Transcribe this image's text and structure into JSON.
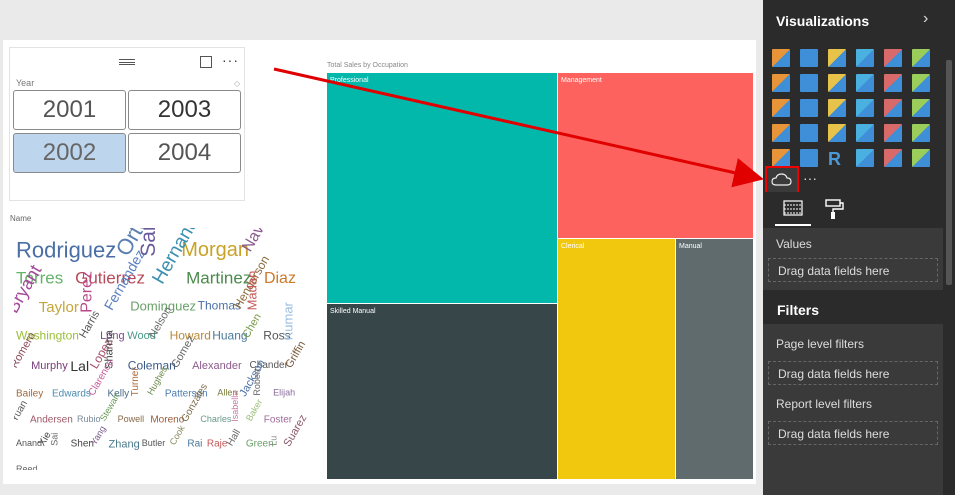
{
  "slicer": {
    "title": "Year",
    "years": [
      "2001",
      "2003",
      "2002",
      "2004"
    ],
    "selected": "2002",
    "more": "···"
  },
  "wordcloud": {
    "title": "Name",
    "words": [
      {
        "t": "Rodriguez",
        "c": "#4a6fa5"
      },
      {
        "t": "Ortega",
        "c": "#5b7fb0"
      },
      {
        "t": "Sanchez",
        "c": "#6a5a9c"
      },
      {
        "t": "Morgan",
        "c": "#c9a227"
      },
      {
        "t": "Navarro",
        "c": "#8b5a8c"
      },
      {
        "t": "Torres",
        "c": "#66b36a"
      },
      {
        "t": "Gutierrez",
        "c": "#b84a5a"
      },
      {
        "t": "Hernandez",
        "c": "#3b8fb0"
      },
      {
        "t": "Martinez",
        "c": "#4a8a4a"
      },
      {
        "t": "Diaz",
        "c": "#c97a2a"
      },
      {
        "t": "Bryant",
        "c": "#a34a9a"
      },
      {
        "t": "Taylor",
        "c": "#c4a63a"
      },
      {
        "t": "Perez",
        "c": "#b84a8a"
      },
      {
        "t": "Fernandez",
        "c": "#5a7fc0"
      },
      {
        "t": "Dominguez",
        "c": "#6aa06a"
      },
      {
        "t": "Thomas",
        "c": "#4a6fa5"
      },
      {
        "t": "Henderson",
        "c": "#8a6a3a"
      },
      {
        "t": "Madan",
        "c": "#c45a5a"
      },
      {
        "t": "Washington",
        "c": "#9abf3a"
      },
      {
        "t": "Harris",
        "c": "#555"
      },
      {
        "t": "Long",
        "c": "#7a4a8a"
      },
      {
        "t": "Wood",
        "c": "#4a9a8a"
      },
      {
        "t": "Nelson",
        "c": "#6a6a6a"
      },
      {
        "t": "Howard",
        "c": "#b8893a"
      },
      {
        "t": "Huang",
        "c": "#4a7a9a"
      },
      {
        "t": "Chen",
        "c": "#7a9a4a"
      },
      {
        "t": "Ross",
        "c": "#555"
      },
      {
        "t": "Kumar",
        "c": "#9abfe0"
      },
      {
        "t": "Romero",
        "c": "#8a4a5a"
      },
      {
        "t": "Murphy",
        "c": "#7a3a7a"
      },
      {
        "t": "Lal",
        "c": "#333"
      },
      {
        "t": "Lopez",
        "c": "#a34a6a"
      },
      {
        "t": "Sharma",
        "c": "#444"
      },
      {
        "t": "Coleman",
        "c": "#3a5a8a"
      },
      {
        "t": "Gomez",
        "c": "#666"
      },
      {
        "t": "Alexander",
        "c": "#8a5a8a"
      },
      {
        "t": "Chander",
        "c": "#555"
      },
      {
        "t": "Griffin",
        "c": "#7a5a3a"
      },
      {
        "t": "Bailey",
        "c": "#a06a3a"
      },
      {
        "t": "Edwards",
        "c": "#4a8ab0"
      },
      {
        "t": "Clarence",
        "c": "#c45a9a"
      },
      {
        "t": "Kelly",
        "c": "#4a6a8a"
      },
      {
        "t": "Turner",
        "c": "#b06a3a"
      },
      {
        "t": "Hughes",
        "c": "#6a8a4a"
      },
      {
        "t": "Patterson",
        "c": "#4a7ab0"
      },
      {
        "t": "Allen",
        "c": "#7a7a3a"
      },
      {
        "t": "Jackson",
        "c": "#4a6fa5"
      },
      {
        "t": "Robert",
        "c": "#666"
      },
      {
        "t": "Elijah",
        "c": "#8a6a9a"
      },
      {
        "t": "Yuan",
        "c": "#555"
      },
      {
        "t": "Andersen",
        "c": "#a05a6a"
      },
      {
        "t": "Rubio",
        "c": "#7a8a9a"
      },
      {
        "t": "Stewart",
        "c": "#6a9a5a"
      },
      {
        "t": "Powell",
        "c": "#8a6a4a"
      },
      {
        "t": "Moreno",
        "c": "#9a5a3a"
      },
      {
        "t": "Gonzales",
        "c": "#7a6a4a"
      },
      {
        "t": "Charles",
        "c": "#6a9a8a"
      },
      {
        "t": "Isabella",
        "c": "#c97aa0"
      },
      {
        "t": "Baker",
        "c": "#9abf7a"
      },
      {
        "t": "Foster",
        "c": "#a06a9a"
      },
      {
        "t": "Anand",
        "c": "#555"
      },
      {
        "t": "Xie",
        "c": "#444"
      },
      {
        "t": "Sai",
        "c": "#666"
      },
      {
        "t": "Shen",
        "c": "#444"
      },
      {
        "t": "Yang",
        "c": "#7a5a8a"
      },
      {
        "t": "Zhang",
        "c": "#4a7a8a"
      },
      {
        "t": "Butler",
        "c": "#555"
      },
      {
        "t": "Cook",
        "c": "#8a8a5a"
      },
      {
        "t": "Rai",
        "c": "#4a7a9a"
      },
      {
        "t": "Raje",
        "c": "#c45a5a"
      },
      {
        "t": "Hall",
        "c": "#666"
      },
      {
        "t": "Green",
        "c": "#6aa06a"
      },
      {
        "t": "Lu",
        "c": "#888"
      },
      {
        "t": "Suarez",
        "c": "#8a5a6a"
      },
      {
        "t": "Reed",
        "c": "#666"
      }
    ]
  },
  "treemap": {
    "title": "Total Sales by Occupation",
    "cells": [
      {
        "label": "Professional",
        "color": "#01b8aa"
      },
      {
        "label": "Management",
        "color": "#fd625e"
      },
      {
        "label": "Skilled Manual",
        "color": "#374649"
      },
      {
        "label": "Clerical",
        "color": "#f2c80f"
      },
      {
        "label": "Manual",
        "color": "#5f6b6d"
      }
    ]
  },
  "panel": {
    "title": "Visualizations",
    "more": "···",
    "values_label": "Values",
    "drop_hint": "Drag data fields here",
    "filters_title": "Filters",
    "page_filters": "Page level filters",
    "report_filters": "Report level filters"
  },
  "colors": {
    "accent": "#01b8aa",
    "arrow": "#e00000",
    "panel_bg": "#2b2b2b"
  }
}
